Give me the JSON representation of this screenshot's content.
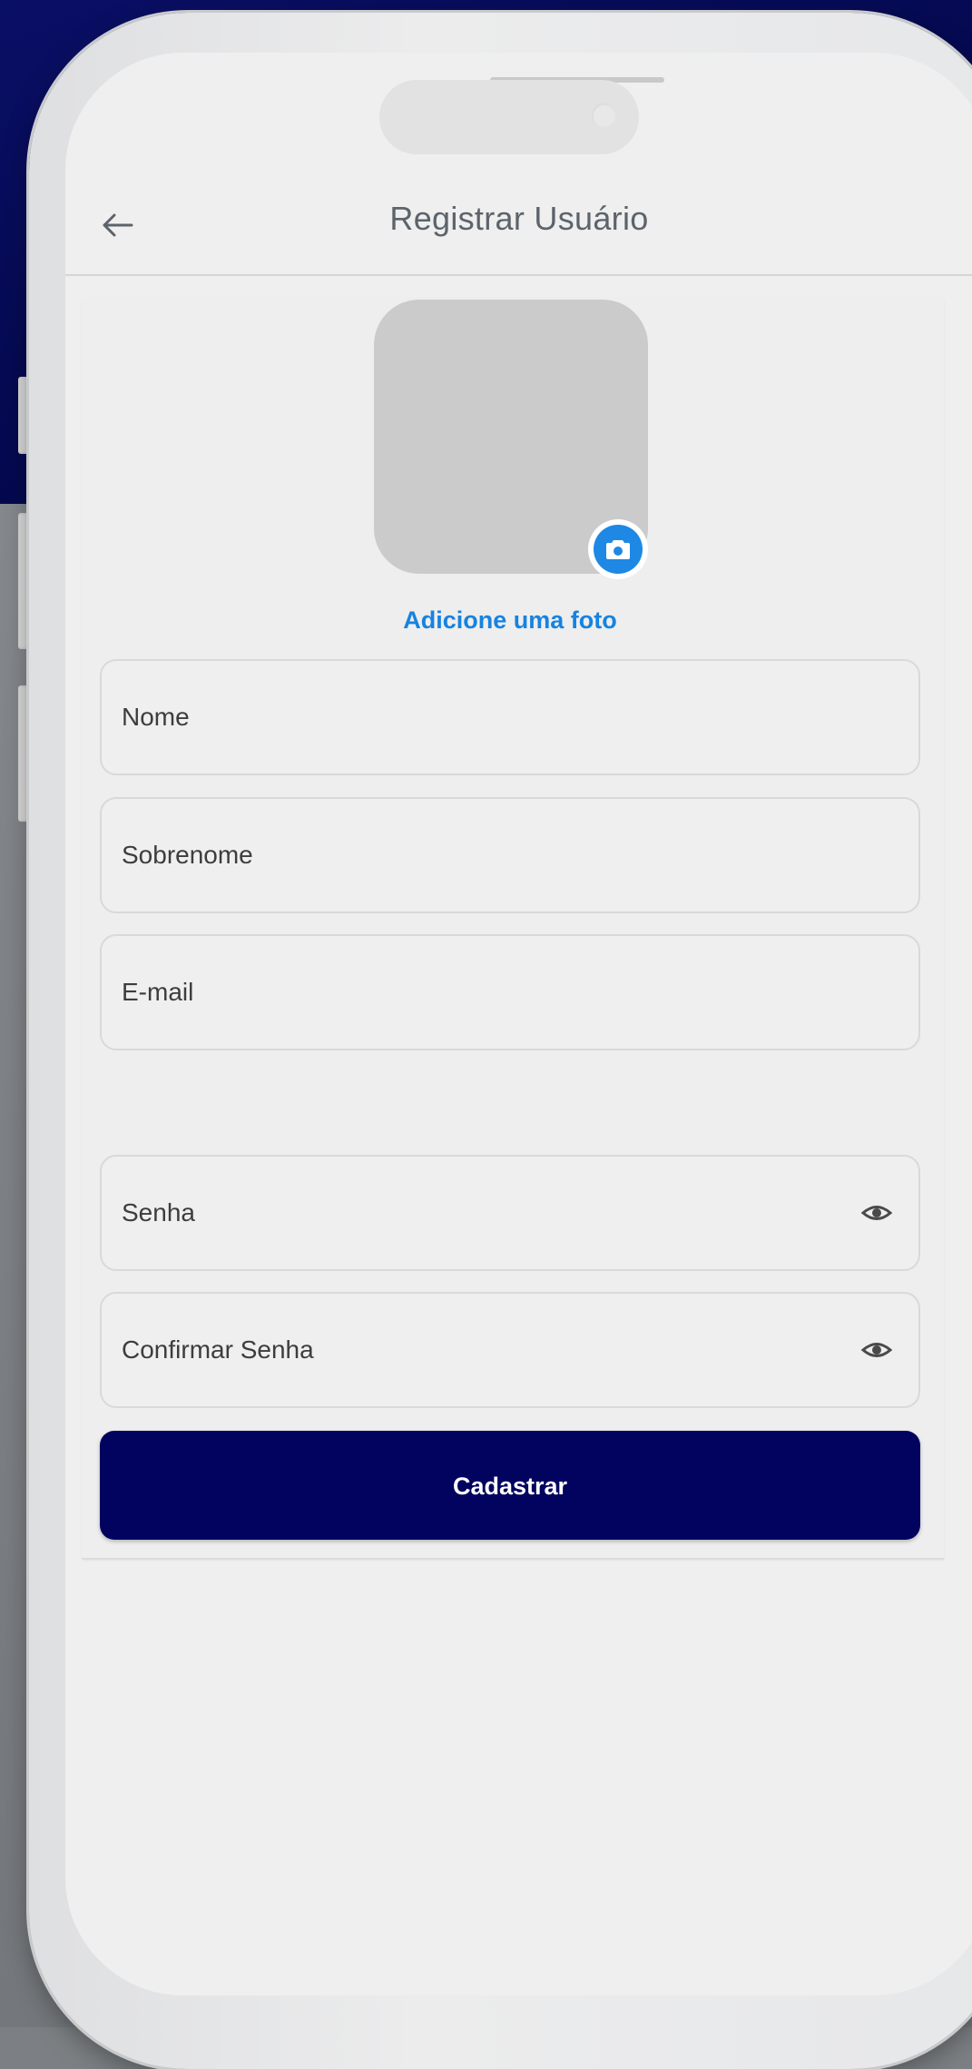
{
  "app": {
    "title": "Registrar Usuário"
  },
  "header": {
    "back_icon": "arrow-left-icon",
    "title": "Registrar Usuário"
  },
  "photo": {
    "add_label": "Adicione uma foto",
    "camera_icon": "camera-icon"
  },
  "form": {
    "fields": [
      {
        "placeholder": "Nome",
        "value": ""
      },
      {
        "placeholder": "Sobrenome",
        "value": ""
      },
      {
        "placeholder": "E-mail",
        "value": ""
      },
      {
        "placeholder": "Senha",
        "value": "",
        "icon": "eye-icon"
      },
      {
        "placeholder": "Confirmar Senha",
        "value": "",
        "icon": "eye-icon"
      }
    ],
    "submit_label": "Cadastrar"
  },
  "colors": {
    "primary": "#02025f",
    "accent": "#1683e0",
    "background_top": "#050a52",
    "background_bottom": "#7c8084"
  }
}
